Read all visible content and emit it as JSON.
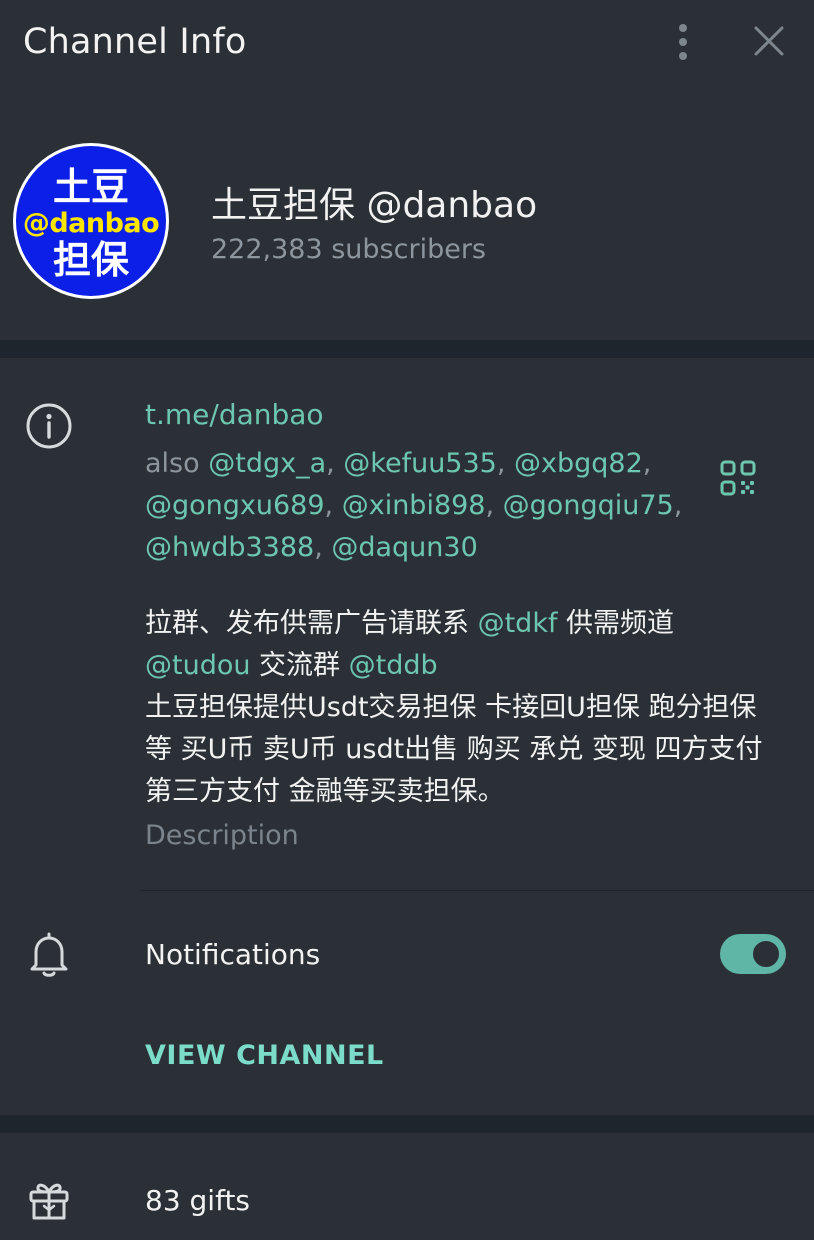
{
  "header": {
    "title": "Channel Info",
    "menu_icon": "more-vertical-icon",
    "close_icon": "close-icon"
  },
  "channel": {
    "avatar": {
      "line1": "土豆",
      "line2": "@danbao",
      "line3": "担保"
    },
    "name": "土豆担保 @danbao",
    "subscribers": "222,383 subscribers"
  },
  "info": {
    "url": "t.me/danbao",
    "also_prefix": "also",
    "usernames": [
      "@tdgx_a",
      "@kefuu535",
      "@xbgq82",
      "@gongxu689",
      "@xinbi898",
      "@gongqiu75",
      "@hwdb3388",
      "@daqun30"
    ],
    "description": {
      "t1": "拉群、发布供需广告请联系 ",
      "l1": "@tdkf",
      "t2": " 供需频道 ",
      "l2": "@tudou",
      "t3": " 交流群 ",
      "l3": "@tddb",
      "t4": "土豆担保提供Usdt交易担保 卡接回U担保 跑分担保等 买U币 卖U币 usdt出售 购买 承兑 变现 四方支付 第三方支付 金融等买卖担保。"
    },
    "description_label": "Description"
  },
  "notifications": {
    "label": "Notifications",
    "enabled": true
  },
  "view_channel": "VIEW CHANNEL",
  "gifts": {
    "label": "83 gifts"
  },
  "colors": {
    "accent": "#6cc7ae",
    "toggle": "#5fb5a6",
    "panel": "#2b3036",
    "avatar_bg": "#0b1fe6",
    "avatar_mid": "#ffe600"
  }
}
